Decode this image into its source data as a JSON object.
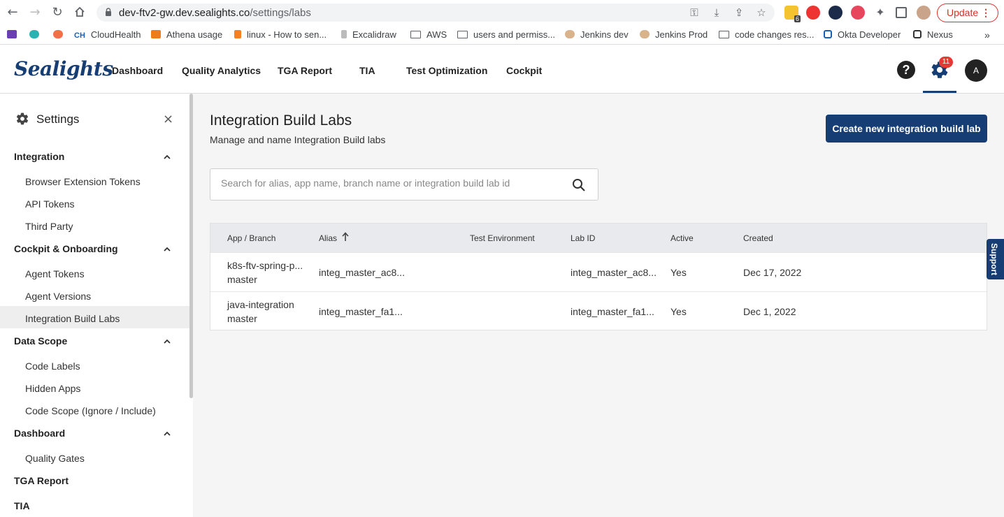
{
  "browser": {
    "url_host": "dev-ftv2-gw.dev.sealights.co",
    "url_path": "/settings/labs",
    "ext_badge": "6",
    "update_label": "Update",
    "update_dots": "⋮"
  },
  "bookmarks": [
    {
      "label": "CloudHealth",
      "prefix": "CH"
    },
    {
      "label": "Athena usage"
    },
    {
      "label": "linux - How to sen..."
    },
    {
      "label": "Excalidraw"
    },
    {
      "label": "AWS"
    },
    {
      "label": "users and permiss..."
    },
    {
      "label": "Jenkins dev"
    },
    {
      "label": "Jenkins Prod"
    },
    {
      "label": "code changes res..."
    },
    {
      "label": "Okta Developer"
    },
    {
      "label": "Nexus"
    }
  ],
  "bookmarks_more": "»",
  "app": {
    "logo": "Sealights",
    "nav": [
      "Dashboard",
      "Quality Analytics",
      "TGA Report",
      "TIA",
      "Test Optimization",
      "Cockpit"
    ],
    "help": "?",
    "notifications": "11",
    "avatar": "A"
  },
  "sidebar": {
    "title": "Settings",
    "close": "×",
    "sections": [
      {
        "label": "Integration",
        "items": [
          "Browser Extension Tokens",
          "API Tokens",
          "Third Party"
        ]
      },
      {
        "label": "Cockpit & Onboarding",
        "items": [
          "Agent Tokens",
          "Agent Versions",
          "Integration Build Labs"
        ]
      },
      {
        "label": "Data Scope",
        "items": [
          "Code Labels",
          "Hidden Apps",
          "Code Scope (Ignore / Include)"
        ]
      },
      {
        "label": "Dashboard",
        "items": [
          "Quality Gates"
        ]
      },
      {
        "label": "TGA Report",
        "items": []
      },
      {
        "label": "TIA",
        "items": []
      }
    ]
  },
  "main": {
    "title": "Integration Build Labs",
    "subtitle": "Manage and name Integration Build labs",
    "create_button": "Create new integration build lab",
    "search_placeholder": "Search for alias, app name, branch name or integration build lab id",
    "columns": [
      "App / Branch",
      "Alias",
      "Test Environment",
      "Lab ID",
      "Active",
      "Created"
    ],
    "rows": [
      {
        "app": "k8s-ftv-spring-p...",
        "branch": "master",
        "alias": "integ_master_ac8...",
        "env": "",
        "lab_id": "integ_master_ac8...",
        "active": "Yes",
        "created": "Dec 17, 2022"
      },
      {
        "app": "java-integration",
        "branch": "master",
        "alias": "integ_master_fa1...",
        "env": "",
        "lab_id": "integ_master_fa1...",
        "active": "Yes",
        "created": "Dec 1, 2022"
      }
    ]
  },
  "support_label": "Support",
  "colors": {
    "brand": "#173e74",
    "badge": "#e53935"
  }
}
